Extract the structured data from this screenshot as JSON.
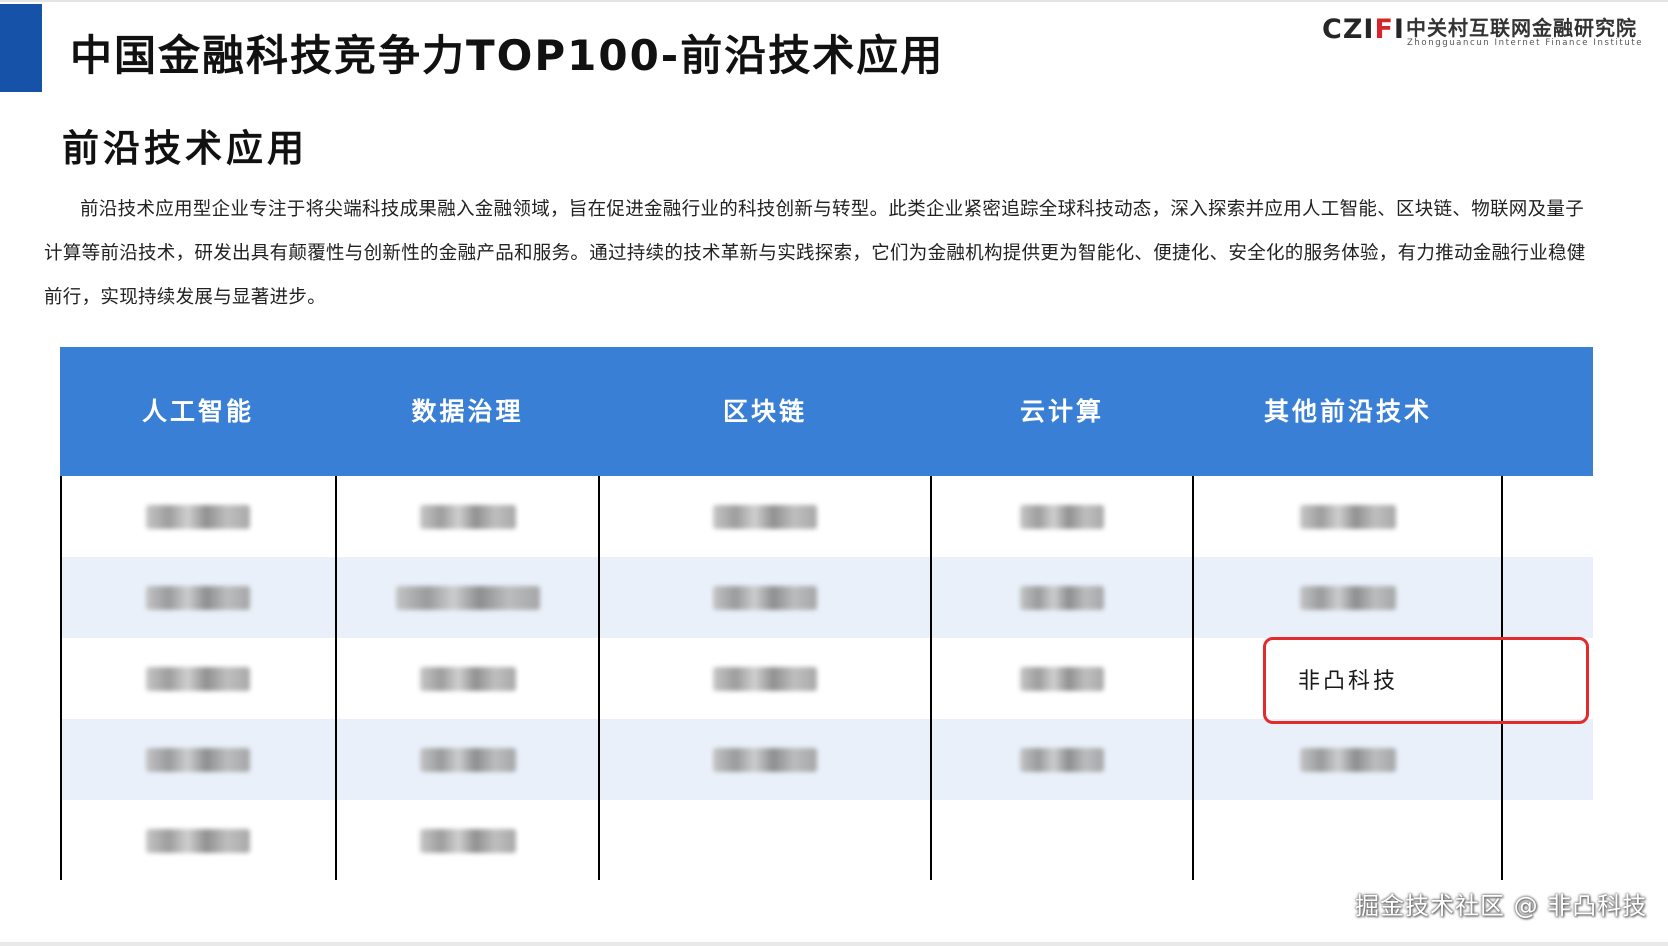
{
  "header": {
    "title": "中国金融科技竞争力TOP100-前沿技术应用",
    "logo": {
      "mark_parts": [
        "C",
        "Z",
        "I",
        "F",
        "I"
      ],
      "name_cn": "中关村互联网金融研究院",
      "name_en": "Zhongguancun Internet Finance Institute"
    }
  },
  "section": {
    "title": "前沿技术应用",
    "intro": "前沿技术应用型企业专注于将尖端科技成果融入金融领域，旨在促进金融行业的科技创新与转型。此类企业紧密追踪全球科技动态，深入探索并应用人工智能、区块链、物联网及量子计算等前沿技术，研发出具有颠覆性与创新性的金融产品和服务。通过持续的技术革新与实践探索，它们为金融机构提供更为智能化、便捷化、安全化的服务体验，有力推动金融行业稳健前行，实现持续发展与显著进步。"
  },
  "table": {
    "columns": [
      "人工智能",
      "数据治理",
      "区块链",
      "云计算",
      "其他前沿技术"
    ],
    "rows": [
      [
        "[blurred]",
        "[blurred]",
        "[blurred]",
        "[blurred]",
        "[blurred]"
      ],
      [
        "[blurred]",
        "[blurred]",
        "[blurred]",
        "[blurred]",
        "[blurred]"
      ],
      [
        "[blurred]",
        "[blurred]",
        "[blurred]",
        "[blurred]",
        "非凸科技"
      ],
      [
        "[blurred]",
        "[blurred]",
        "[blurred]",
        "[blurred]",
        "[blurred]"
      ],
      [
        "[blurred]",
        "[blurred]",
        "",
        "",
        ""
      ]
    ],
    "highlighted_entry": "非凸科技",
    "colors": {
      "header_bg": "#3a7fd6",
      "band_bg": "#eaf0fa",
      "highlight_border": "#e32b2b",
      "accent": "#1552a8"
    }
  },
  "watermark": "掘金技术社区 @ 非凸科技"
}
